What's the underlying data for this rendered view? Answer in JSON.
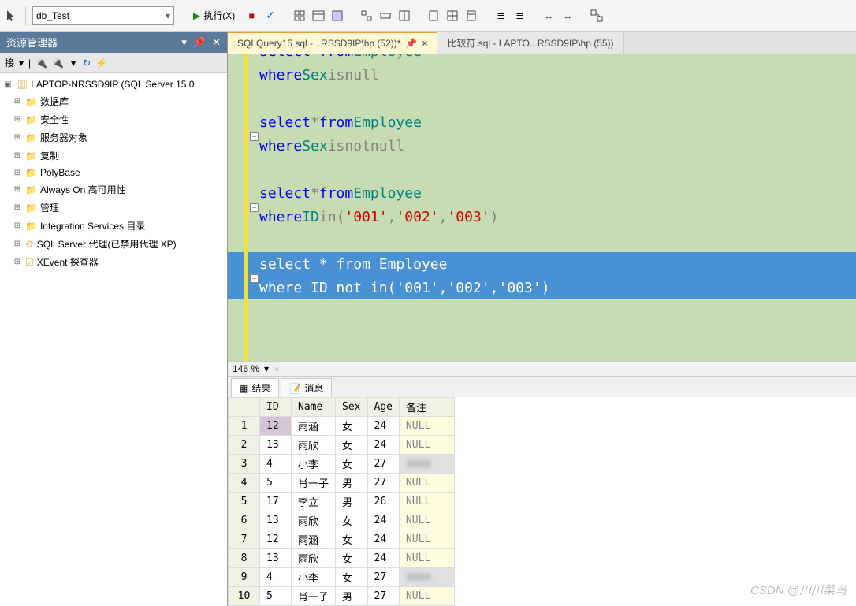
{
  "toolbar": {
    "db_name": "db_Test",
    "execute_label": "执行(X)"
  },
  "sidebar": {
    "title": "资源管理器",
    "connect_label": "接",
    "server_label": "LAPTOP-NRSSD9IP (SQL Server 15.0.",
    "nodes": [
      {
        "label": "数据库",
        "type": "folder"
      },
      {
        "label": "安全性",
        "type": "folder"
      },
      {
        "label": "服务器对象",
        "type": "folder"
      },
      {
        "label": "复制",
        "type": "folder"
      },
      {
        "label": "PolyBase",
        "type": "folder"
      },
      {
        "label": "Always On 高可用性",
        "type": "folder"
      },
      {
        "label": "管理",
        "type": "folder"
      },
      {
        "label": "Integration Services 目录",
        "type": "folder"
      },
      {
        "label": "SQL Server 代理(已禁用代理 XP)",
        "type": "agent"
      },
      {
        "label": "XEvent 探查器",
        "type": "xevent"
      }
    ]
  },
  "tabs": {
    "active_tab": "SQLQuery15.sql -...RSSD9IP\\hp (52))*",
    "inactive_tab": "比较符.sql - LAPTO...RSSD9IP\\hp (55))"
  },
  "editor": {
    "lines": [
      {
        "tokens": [
          {
            "t": "select",
            "c": "blue"
          },
          {
            "t": " * ",
            "c": "gray"
          },
          {
            "t": "from",
            "c": "blue"
          },
          {
            "t": " Employee",
            "c": "green"
          }
        ],
        "collapse": false,
        "partial": true
      },
      {
        "tokens": [
          {
            "t": "where",
            "c": "blue"
          },
          {
            "t": " Sex ",
            "c": "green"
          },
          {
            "t": "is",
            "c": "gray"
          },
          {
            "t": " ",
            "c": ""
          },
          {
            "t": "null",
            "c": "gray"
          }
        ]
      },
      {
        "tokens": []
      },
      {
        "tokens": [
          {
            "t": "select",
            "c": "blue"
          },
          {
            "t": " ",
            "c": ""
          },
          {
            "t": "*",
            "c": "gray"
          },
          {
            "t": " ",
            "c": ""
          },
          {
            "t": "from",
            "c": "blue"
          },
          {
            "t": " Employee",
            "c": "green"
          }
        ],
        "collapse": true
      },
      {
        "tokens": [
          {
            "t": "where",
            "c": "blue"
          },
          {
            "t": " Sex ",
            "c": "green"
          },
          {
            "t": "is",
            "c": "gray"
          },
          {
            "t": "  ",
            "c": ""
          },
          {
            "t": "not",
            "c": "gray"
          },
          {
            "t": " ",
            "c": ""
          },
          {
            "t": "null",
            "c": "gray"
          }
        ]
      },
      {
        "tokens": []
      },
      {
        "tokens": [
          {
            "t": "select",
            "c": "blue"
          },
          {
            "t": " ",
            "c": ""
          },
          {
            "t": "*",
            "c": "gray"
          },
          {
            "t": " ",
            "c": ""
          },
          {
            "t": "from",
            "c": "blue"
          },
          {
            "t": " Employee",
            "c": "green"
          }
        ],
        "collapse": true
      },
      {
        "tokens": [
          {
            "t": "where",
            "c": "blue"
          },
          {
            "t": " ID ",
            "c": "green"
          },
          {
            "t": "in",
            "c": "gray"
          },
          {
            "t": "(",
            "c": "gray"
          },
          {
            "t": "'001'",
            "c": "red"
          },
          {
            "t": ",",
            "c": "gray"
          },
          {
            "t": "'002'",
            "c": "red"
          },
          {
            "t": ",",
            "c": "gray"
          },
          {
            "t": "'003'",
            "c": "red"
          },
          {
            "t": ")",
            "c": "gray"
          }
        ]
      },
      {
        "tokens": []
      },
      {
        "tokens": [
          {
            "t": "select",
            "c": "blue"
          },
          {
            "t": " ",
            "c": ""
          },
          {
            "t": "*",
            "c": "gray"
          },
          {
            "t": " ",
            "c": ""
          },
          {
            "t": "from",
            "c": "blue"
          },
          {
            "t": " Employee",
            "c": "green"
          }
        ],
        "collapse": true,
        "selected": true
      },
      {
        "tokens": [
          {
            "t": "where",
            "c": "blue"
          },
          {
            "t": " ID ",
            "c": "green"
          },
          {
            "t": "not",
            "c": "gray"
          },
          {
            "t": " ",
            "c": ""
          },
          {
            "t": "in",
            "c": "gray"
          },
          {
            "t": "(",
            "c": "gray"
          },
          {
            "t": "'001'",
            "c": "red"
          },
          {
            "t": ",",
            "c": "gray"
          },
          {
            "t": "'002'",
            "c": "red"
          },
          {
            "t": ",",
            "c": "gray"
          },
          {
            "t": "'003'",
            "c": "red"
          },
          {
            "t": ")",
            "c": "gray"
          }
        ],
        "selected": true
      }
    ]
  },
  "zoom": {
    "value": "146 %"
  },
  "results": {
    "tab_results": "结果",
    "tab_messages": "消息",
    "columns": [
      "ID",
      "Name",
      "Sex",
      "Age",
      "备注"
    ],
    "rows": [
      {
        "n": "1",
        "id": "12",
        "name": "雨涵",
        "sex": "女",
        "age": "24",
        "remark": "NULL",
        "idsel": true,
        "null": true
      },
      {
        "n": "2",
        "id": "13",
        "name": "雨欣",
        "sex": "女",
        "age": "24",
        "remark": "NULL",
        "null": true
      },
      {
        "n": "3",
        "id": "4",
        "name": "小李",
        "sex": "女",
        "age": "27",
        "remark": "",
        "blur": true
      },
      {
        "n": "4",
        "id": "5",
        "name": "肖一子",
        "sex": "男",
        "age": "27",
        "remark": "NULL",
        "null": true
      },
      {
        "n": "5",
        "id": "17",
        "name": "李立",
        "sex": "男",
        "age": "26",
        "remark": "NULL",
        "null": true
      },
      {
        "n": "6",
        "id": "13",
        "name": "雨欣",
        "sex": "女",
        "age": "24",
        "remark": "NULL",
        "null": true
      },
      {
        "n": "7",
        "id": "12",
        "name": "雨涵",
        "sex": "女",
        "age": "24",
        "remark": "NULL",
        "null": true
      },
      {
        "n": "8",
        "id": "13",
        "name": "雨欣",
        "sex": "女",
        "age": "24",
        "remark": "NULL",
        "null": true
      },
      {
        "n": "9",
        "id": "4",
        "name": "小李",
        "sex": "女",
        "age": "27",
        "remark": "",
        "blur": true
      },
      {
        "n": "10",
        "id": "5",
        "name": "肖一子",
        "sex": "男",
        "age": "27",
        "remark": "NULL",
        "null": true
      }
    ]
  },
  "watermark": "CSDN @川川菜鸟"
}
